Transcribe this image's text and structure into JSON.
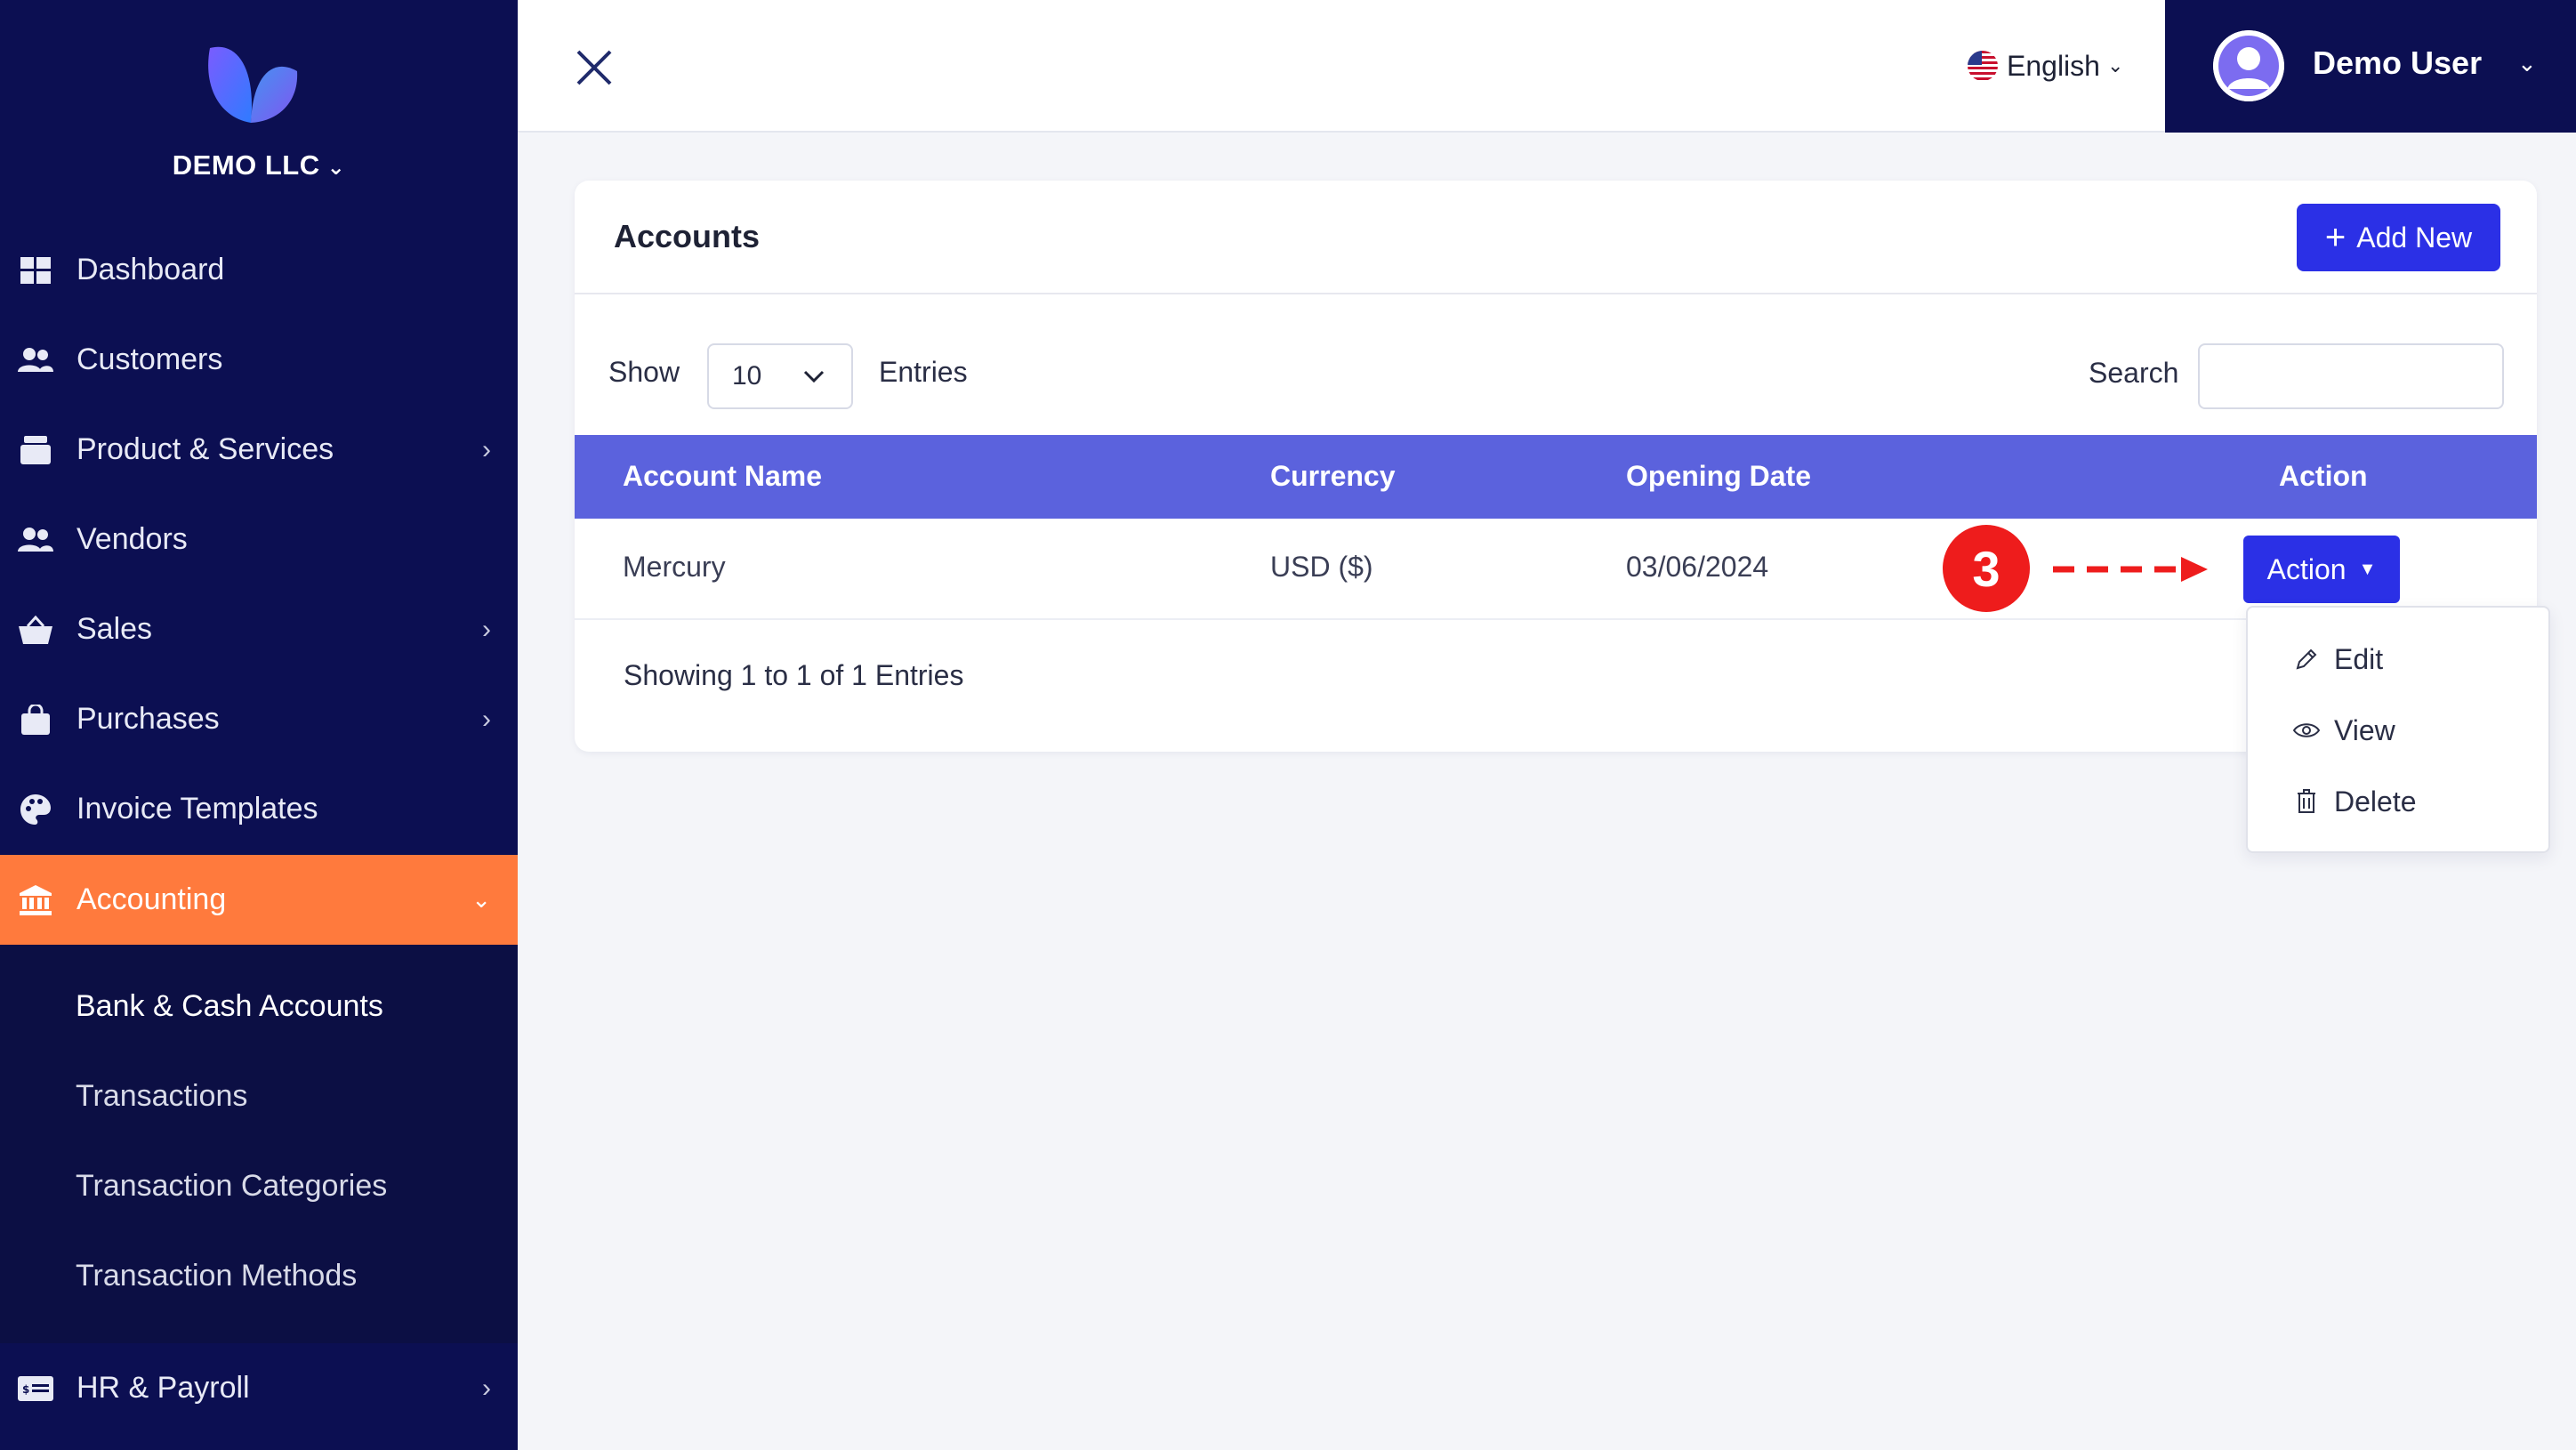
{
  "sidebar": {
    "company": "DEMO LLC",
    "items": [
      {
        "label": "Dashboard",
        "icon": "dashboard-grid-icon"
      },
      {
        "label": "Customers",
        "icon": "users-icon"
      },
      {
        "label": "Product & Services",
        "icon": "box-icon",
        "has_children": true
      },
      {
        "label": "Vendors",
        "icon": "users-icon"
      },
      {
        "label": "Sales",
        "icon": "basket-icon",
        "has_children": true
      },
      {
        "label": "Purchases",
        "icon": "shopping-bag-icon",
        "has_children": true
      },
      {
        "label": "Invoice Templates",
        "icon": "palette-icon"
      },
      {
        "label": "Accounting",
        "icon": "bank-icon",
        "has_children": true,
        "active": true
      }
    ],
    "submenu": [
      {
        "label": "Bank & Cash Accounts",
        "current": true
      },
      {
        "label": "Transactions"
      },
      {
        "label": "Transaction Categories"
      },
      {
        "label": "Transaction Methods"
      }
    ],
    "bottom_item": {
      "label": "HR & Payroll",
      "icon": "payroll-card-icon"
    }
  },
  "topbar": {
    "language": "English",
    "user_name": "Demo User"
  },
  "card": {
    "title": "Accounts",
    "add_button": "Add New",
    "show_label": "Show",
    "show_value": "10",
    "entries_label": "Entries",
    "search_label": "Search",
    "search_value": "",
    "footer": "Showing 1 to 1 of 1 Entries"
  },
  "table": {
    "headers": [
      "Account Name",
      "Currency",
      "Opening Date",
      "Action"
    ],
    "rows": [
      {
        "account_name": "Mercury",
        "currency": "USD ($)",
        "opening_date": "03/06/2024",
        "action": "Action"
      }
    ]
  },
  "annotation": {
    "step": "3",
    "color": "#ee1c1c"
  },
  "dropdown": {
    "items": [
      {
        "label": "Edit",
        "icon": "pencil-icon"
      },
      {
        "label": "View",
        "icon": "eye-icon"
      },
      {
        "label": "Delete",
        "icon": "trash-icon"
      }
    ]
  },
  "colors": {
    "sidebar_bg": "#0c0f52",
    "active_item": "#ff7a3d",
    "primary_button": "#2b30e6",
    "table_header": "#5b62dd"
  }
}
